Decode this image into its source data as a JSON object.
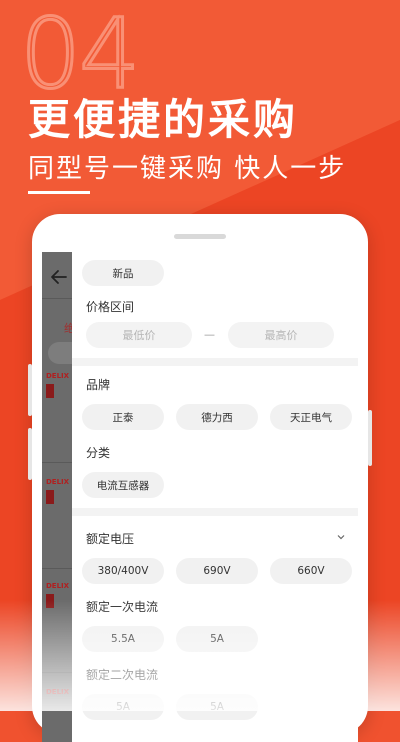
{
  "banner": {
    "number": "04",
    "headline": "更便捷的采购",
    "subline": "同型号一键采购 快人一步"
  },
  "colors": {
    "background": "#f0522f",
    "accent_dark": "#e0401f"
  },
  "under_page": {
    "back_icon": "arrow-left-icon",
    "brand_label": "DELIX"
  },
  "filter": {
    "condition_chip": "新品",
    "price": {
      "title": "价格区间",
      "min_placeholder": "最低价",
      "separator": "—",
      "max_placeholder": "最高价"
    },
    "brand": {
      "title": "品牌",
      "options": [
        "正泰",
        "德力西",
        "天正电气"
      ]
    },
    "category": {
      "title": "分类",
      "options": [
        "电流互感器"
      ]
    },
    "rated_voltage": {
      "title": "额定电压",
      "expand_icon": "chevron-down-icon",
      "options": [
        "380/400V",
        "690V",
        "660V"
      ]
    },
    "primary_current": {
      "title": "额定一次电流",
      "options": [
        "5.5A",
        "5A"
      ]
    },
    "secondary_current": {
      "title": "额定二次电流",
      "options": [
        "5A",
        "5A"
      ]
    }
  }
}
